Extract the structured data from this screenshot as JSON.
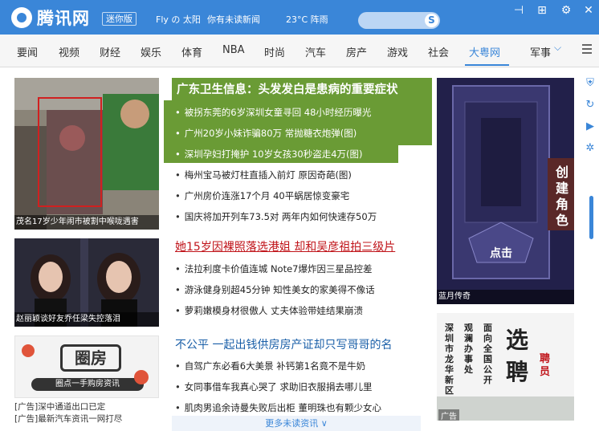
{
  "titlebar": {
    "brand": "腾讯网",
    "mini_label": "迷你版",
    "user": "Fly の 太阳",
    "notice": "你有未读新闻",
    "weather": "23°C  阵雨",
    "search_icon_glyph": "S"
  },
  "window_buttons": {
    "pin": "⊣",
    "new": "⊞",
    "settings": "⚙",
    "close": "✕"
  },
  "nav": {
    "items": [
      "要闻",
      "视频",
      "财经",
      "娱乐",
      "体育",
      "NBA",
      "时尚",
      "汽车",
      "房产",
      "游戏",
      "社会",
      "大粤网"
    ],
    "active_index": 11,
    "more": "军事",
    "accent": "#3a86d8"
  },
  "left": {
    "caption1": "茂名17岁少年闹市被割中喉咙遇害",
    "caption2": "赵丽颖谈好友乔任梁失控落泪",
    "ad_logo": "圈房",
    "ad_slogan": "圈点一手购房资讯",
    "ad1": "[广告]深中通道出口已定",
    "ad2": "[广告]最新汽车资讯一网打尽"
  },
  "middle": {
    "headline1": "广东卫生信息：头发发白是患病的重要症状",
    "group1": [
      "被拐东莞的6岁深圳女童寻回 48小时经历曝光",
      "广州20岁小妹诈骗80万 常抛糖衣炮弹(图)",
      "深圳孕妇打掩护 10岁女孩30秒盗走4万(图)",
      "梅州宝马被灯柱直插入前灯 原因奇葩(图)",
      "广州房价连涨17个月 40平蜗居惊变豪宅",
      "国庆将加开列车73.5对 两年内如何快速存50万"
    ],
    "headline2": "她15岁因裸照落选港姐 却和吴彦祖拍三级片",
    "group2": [
      "法拉利度卡价值连城 Note7爆炸因三星品控差",
      "游泳健身别超45分钟 知性美女的家美得不像话",
      "萝莉嫩模身材很傲人 丈夫体验带娃结果崩溃"
    ],
    "headline3": "不公平 一起出钱供房房产证却只写哥哥的名",
    "group3": [
      "自驾广东必看6大美景 补钙第1名竟不是牛奶",
      "女同事借车我真心哭了 求助旧衣服捐去哪儿里",
      "肌肉男追余诗曼失败后出柜 董明珠也有颗少女心"
    ],
    "more": "更多未读资讯 ∨",
    "highlight_color": "#6a9b35",
    "title_color": "#1a5fa8",
    "red_color": "#c0141a"
  },
  "right": {
    "game_side_text": "创建角色",
    "game_button": "点击",
    "game_caption": "蓝月传奇",
    "recruit_title": "选聘",
    "recruit_sub": "聘员",
    "recruit_col1": "面向全国公开",
    "recruit_col2": "观澜办事处",
    "recruit_col3": "深圳市龙华新区",
    "recruit_ad": "广告"
  },
  "side_icons": [
    "shield-icon",
    "refresh-icon",
    "play-icon",
    "gear-icon"
  ]
}
